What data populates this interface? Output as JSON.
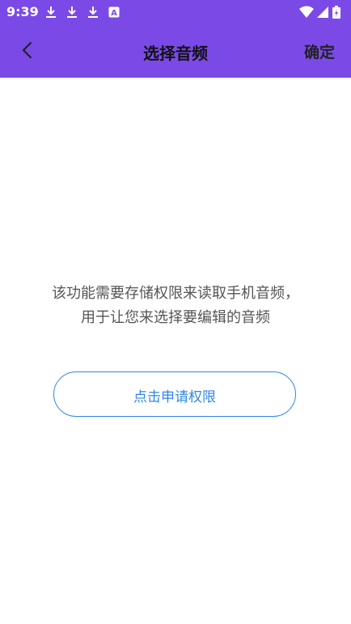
{
  "status_bar": {
    "time": "9:39",
    "icons": [
      "download-icon",
      "download-icon",
      "download-icon",
      "a-app-icon",
      "wifi-icon",
      "signal-icon",
      "battery-icon"
    ]
  },
  "app_bar": {
    "title": "选择音频",
    "confirm_label": "确定",
    "back_icon": "chevron-left-icon",
    "background": "#7b4ae6"
  },
  "content": {
    "message_line1": "该功能需要存储权限来读取手机音频，",
    "message_line2": "用于让您来选择要编辑的音频",
    "permission_button_label": "点击申请权限",
    "accent": "#2f86e8"
  }
}
